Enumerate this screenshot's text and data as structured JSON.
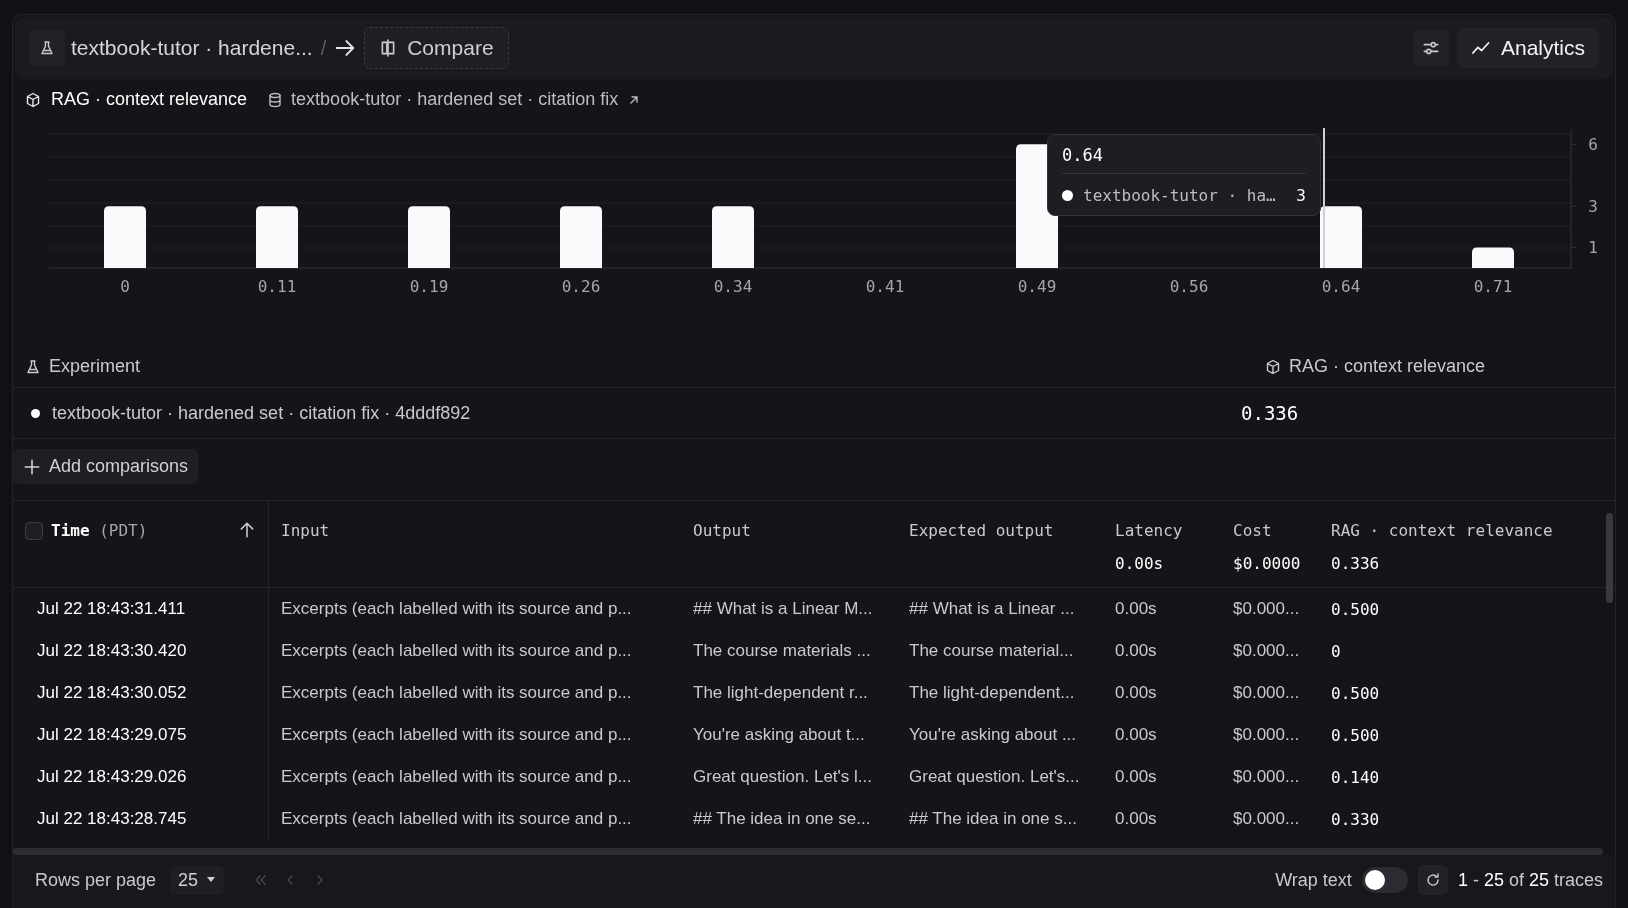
{
  "header": {
    "experiment_crumb": "textbook-tutor · hardene...",
    "separator": "/",
    "compare": "Compare",
    "analytics": "Analytics"
  },
  "subheader": {
    "metric": "RAG · context relevance",
    "dataset": "textbook-tutor · hardened set · citation fix"
  },
  "chart_data": {
    "type": "bar",
    "categories": [
      "0",
      "0.11",
      "0.19",
      "0.26",
      "0.34",
      "0.41",
      "0.49",
      "0.56",
      "0.64",
      "0.71"
    ],
    "values": [
      3,
      3,
      3,
      3,
      3,
      0,
      6,
      0,
      3,
      1
    ],
    "ylim": [
      0,
      6.5
    ],
    "yticks": [
      1,
      3,
      6
    ]
  },
  "tooltip": {
    "title": "0.64",
    "series_name": "textbook-tutor · ha…",
    "value": "3",
    "color": "#ffffff"
  },
  "experiments": {
    "columns": [
      "Experiment",
      "RAG · context relevance"
    ],
    "rows": [
      {
        "name": "textbook-tutor · hardened set · citation fix · 4dddf892",
        "color": "#ffffff",
        "score": "0.336"
      }
    ],
    "add_button": "Add comparisons"
  },
  "table": {
    "select_all_checked": false,
    "columns": [
      {
        "label": "Time",
        "suffix": "(PDT)",
        "sorted": true
      },
      {
        "label": "Input"
      },
      {
        "label": "Output"
      },
      {
        "label": "Expected output"
      },
      {
        "label": "Latency",
        "summary": "0.00s"
      },
      {
        "label": "Cost",
        "summary": "$0.0000"
      },
      {
        "label": "RAG · context relevance",
        "summary": "0.336"
      }
    ],
    "rows": [
      [
        "Jul 22 18:43:31.411",
        "Excerpts (each labelled with its source and p...",
        "## What is a Linear M...",
        "## What is a Linear ...",
        "0.00s",
        "$0.000...",
        "0.500"
      ],
      [
        "Jul 22 18:43:30.420",
        "Excerpts (each labelled with its source and p...",
        "The course materials ...",
        "The course material...",
        "0.00s",
        "$0.000...",
        "0"
      ],
      [
        "Jul 22 18:43:30.052",
        "Excerpts (each labelled with its source and p...",
        "The light-dependent r...",
        "The light-dependent...",
        "0.00s",
        "$0.000...",
        "0.500"
      ],
      [
        "Jul 22 18:43:29.075",
        "Excerpts (each labelled with its source and p...",
        "You're asking about t...",
        "You're asking about ...",
        "0.00s",
        "$0.000...",
        "0.500"
      ],
      [
        "Jul 22 18:43:29.026",
        "Excerpts (each labelled with its source and p...",
        "Great question. Let's l...",
        "Great question. Let's...",
        "0.00s",
        "$0.000...",
        "0.140"
      ],
      [
        "Jul 22 18:43:28.745",
        "Excerpts (each labelled with its source and p...",
        "## The idea in one se...",
        "## The idea in one s...",
        "0.00s",
        "$0.000...",
        "0.330"
      ]
    ]
  },
  "footer": {
    "rows_per_page_label": "Rows per page",
    "rows_per_page": "25",
    "wrap_text_label": "Wrap text",
    "wrap_text_on": false,
    "range": "**1** - **25** of **25** traces"
  }
}
